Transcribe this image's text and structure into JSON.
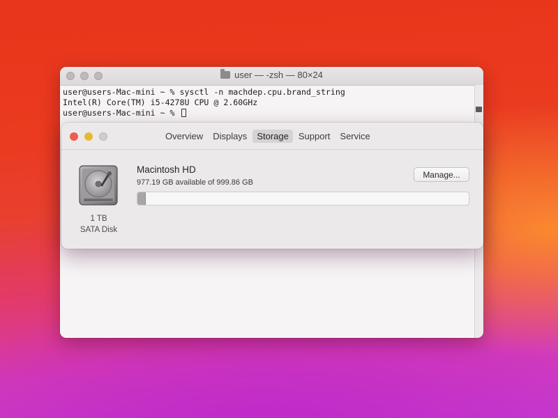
{
  "terminal": {
    "title": "user — -zsh — 80×24",
    "lines": [
      "user@users-Mac-mini ~ % sysctl -n machdep.cpu.brand_string",
      "Intel(R) Core(TM) i5-4278U CPU @ 2.60GHz",
      "user@users-Mac-mini ~ % "
    ]
  },
  "about": {
    "tabs": [
      {
        "label": "Overview",
        "active": false
      },
      {
        "label": "Displays",
        "active": false
      },
      {
        "label": "Storage",
        "active": true
      },
      {
        "label": "Support",
        "active": false
      },
      {
        "label": "Service",
        "active": false
      }
    ],
    "disk": {
      "icon": "hard-drive-icon",
      "size": "1 TB",
      "type": "SATA Disk"
    },
    "volume": {
      "name": "Macintosh HD",
      "available": "977.19 GB available of 999.86 GB",
      "used_fraction": 0.023
    },
    "manage_label": "Manage..."
  },
  "colors": {
    "close": "#ec5c4f",
    "minimize": "#e8b92e",
    "wallpaper_top": "#e8351b",
    "wallpaper_bottom": "#c43ad0"
  }
}
